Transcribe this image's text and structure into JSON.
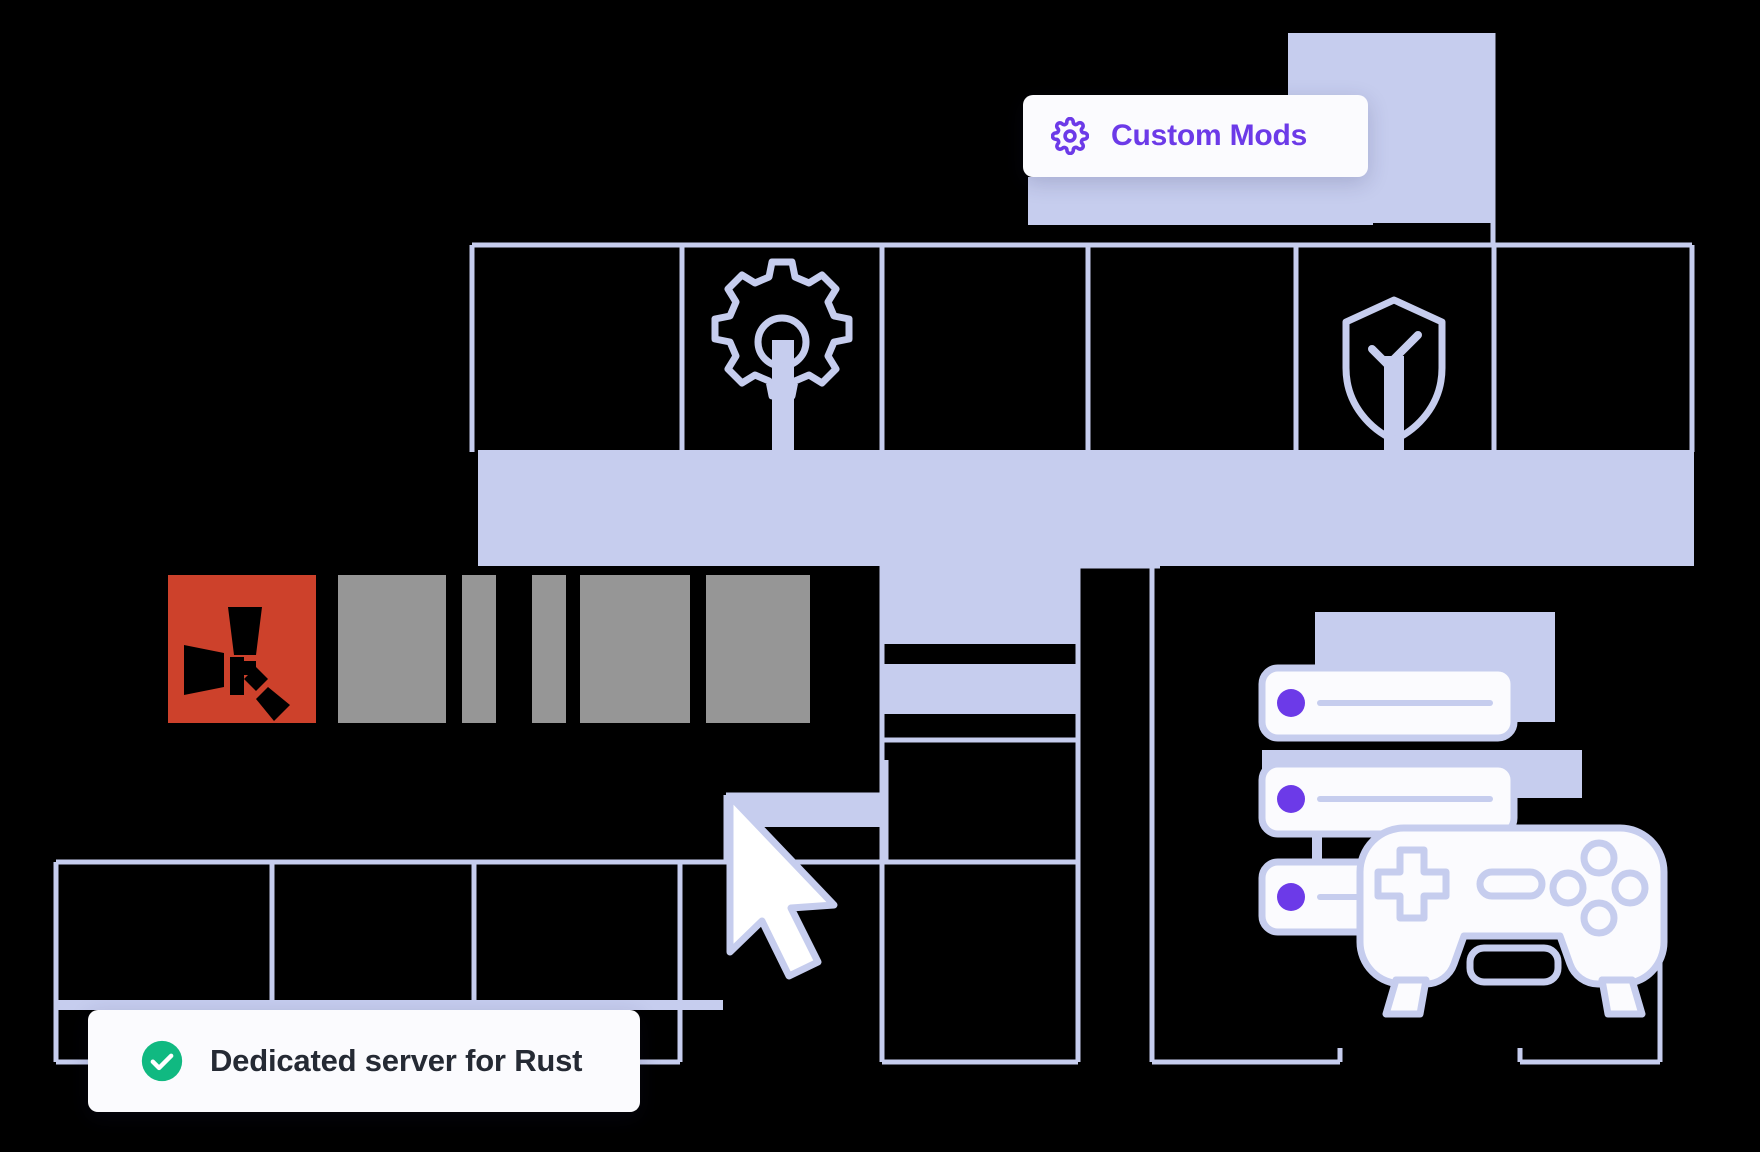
{
  "scene": {
    "title": "Rust dedicated game server hosting illustration",
    "background_color": "#000000",
    "line_color": "#c6cdee",
    "fill_color": "#c6cdee",
    "card_color": "#fbfbfe"
  },
  "chips": [
    {
      "id": "custom-mods",
      "label": "Custom Mods",
      "icon": "gear-icon",
      "icon_color": "#6c3ae8",
      "text_color": "#6c3ae8",
      "background": "#fbfbfe"
    },
    {
      "id": "dedicated-server",
      "label": "Dedicated server for Rust",
      "icon": "check-circle-icon",
      "icon_color": "#10b981",
      "text_color": "#252a34",
      "background": "#fbfbfe"
    }
  ],
  "logo": {
    "name": "RUST",
    "mark_color": "#cd412b",
    "wordmark_color": "#969696",
    "letters": [
      "R",
      "U",
      "S",
      "T"
    ]
  },
  "decorations": {
    "gear_pin": {
      "icon": "gear-icon",
      "color": "#c6cdee"
    },
    "shield_pin": {
      "icon": "shield-check-icon",
      "color": "#c6cdee"
    },
    "cursor": {
      "icon": "cursor-arrow-icon",
      "fill": "#ffffff",
      "stroke": "#c6cdee"
    },
    "server_stack": {
      "icon": "server-stack-icon",
      "units": 3,
      "led_color": "#6c3ae8",
      "panel_color": "#fbfbfe",
      "line_color": "#c6cdee"
    },
    "gamepad": {
      "icon": "gamepad-icon",
      "fill": "#fbfbfe",
      "stroke": "#c6cdee",
      "dpad": "dpad-icon",
      "pill_button": "select-button",
      "face_buttons": 4
    }
  }
}
